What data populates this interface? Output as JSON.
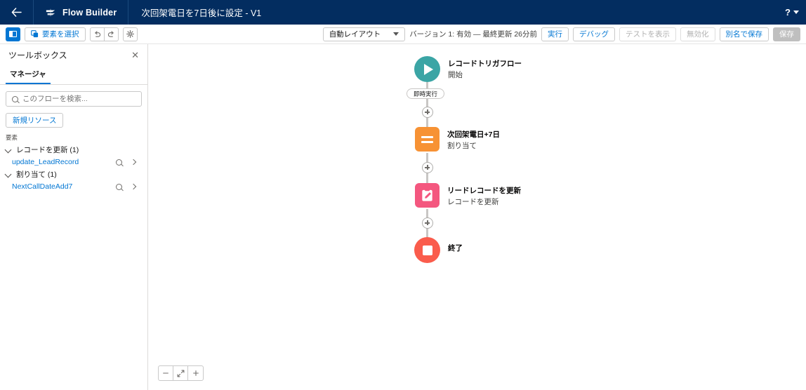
{
  "global_header": {
    "back_icon": "arrow-left-icon",
    "brand_icon": "flow-builder-logo",
    "brand": "Flow Builder",
    "flow_title": "次回架電日を7日後に設定 - V1",
    "help_icon": "question-mark-icon",
    "help_caret": "chevron-down-icon"
  },
  "toolbar": {
    "panel_toggle_name": "toolbox-toggle",
    "select_elements_label": "要素を選択",
    "select_elements_icon": "select-elements-icon",
    "undo_icon": "undo-icon",
    "redo_icon": "redo-icon",
    "settings_icon": "gear-icon",
    "layout_value": "自動レイアウト",
    "version_status": "バージョン 1: 有効 — 最終更新 26分前",
    "run_label": "実行",
    "debug_label": "デバッグ",
    "view_tests_label": "テストを表示",
    "deactivate_label": "無効化",
    "save_as_label": "別名で保存",
    "save_label": "保存"
  },
  "toolbox": {
    "title": "ツールボックス",
    "close_icon": "close-icon",
    "tab_manager": "マネージャ",
    "search_placeholder": "このフローを検索...",
    "search_value": "",
    "search_icon": "search-icon",
    "new_resource_label": "新規リソース",
    "elements_label": "要素",
    "groups": [
      {
        "label": "レコードを更新 (1)",
        "items": [
          {
            "name": "update_LeadRecord"
          }
        ]
      },
      {
        "label": "割り当て (1)",
        "items": [
          {
            "name": "NextCallDateAdd7"
          }
        ]
      }
    ]
  },
  "canvas": {
    "nodes": [
      {
        "id": "start",
        "icon": "play-start-icon",
        "title": "レコードトリガフロー",
        "subtitle": "開始",
        "color": "#3BA5A5"
      },
      {
        "id": "assignment",
        "icon": "assignment-equals-icon",
        "title": "次回架電日+7日",
        "subtitle": "割り当て",
        "color": "#F79234"
      },
      {
        "id": "update-records",
        "icon": "update-records-clipboard-icon",
        "title": "リードレコードを更新",
        "subtitle": "レコードを更新",
        "color": "#F4577F"
      },
      {
        "id": "end",
        "icon": "stop-end-icon",
        "title": "終了",
        "subtitle": "",
        "color": "#FA5C4C"
      }
    ],
    "path_badge": "即時実行",
    "add_element_icon": "plus-circle-icon"
  },
  "zoom_controls": {
    "zoom_out_icon": "minus-icon",
    "fit_icon": "fit-to-view-icon",
    "zoom_in_icon": "plus-icon"
  }
}
